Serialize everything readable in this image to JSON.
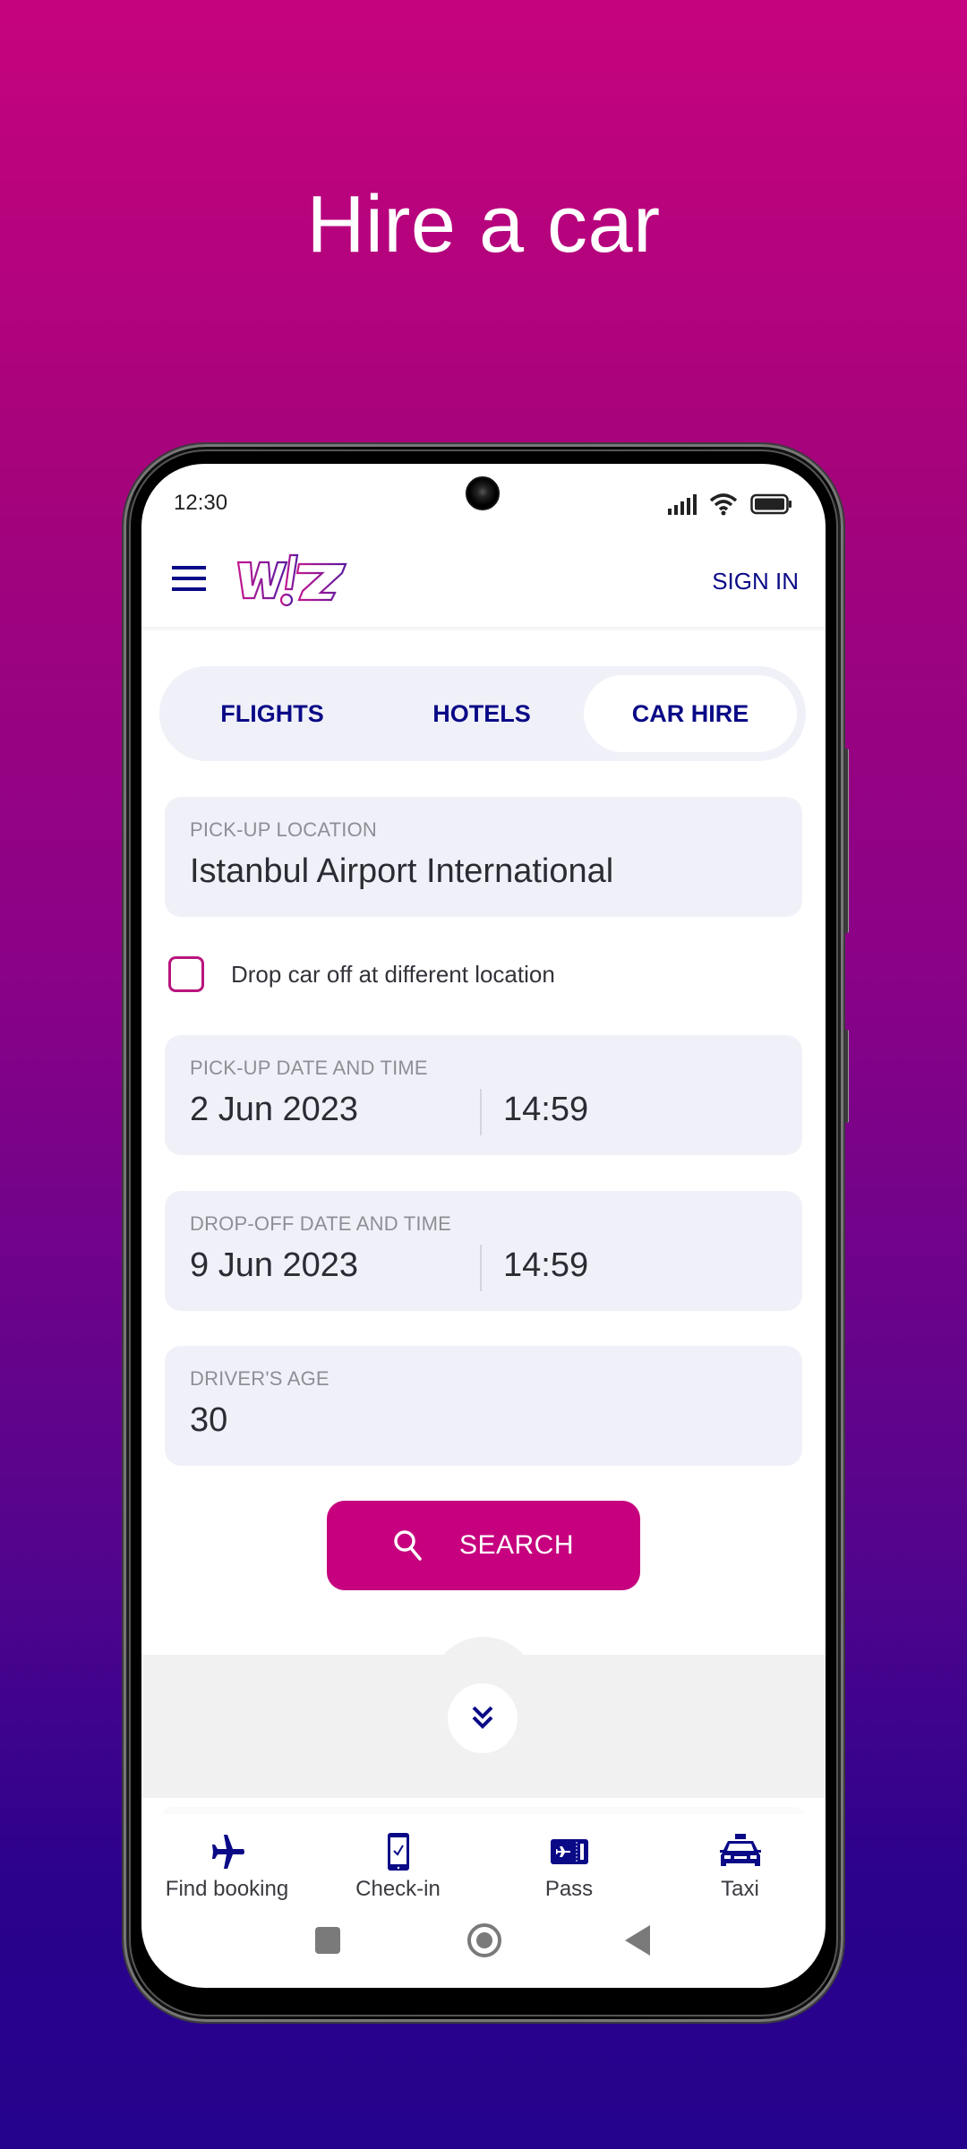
{
  "promo": {
    "headline": "Hire a car"
  },
  "status_bar": {
    "time": "12:30",
    "icons": [
      "signal-icon",
      "wifi-icon",
      "battery-icon"
    ]
  },
  "app_bar": {
    "logo_text": "W!zz",
    "sign_in_label": "SIGN IN"
  },
  "tabs": [
    {
      "label": "FLIGHTS",
      "active": false
    },
    {
      "label": "HOTELS",
      "active": false
    },
    {
      "label": "CAR HIRE",
      "active": true
    }
  ],
  "form": {
    "pickup_location": {
      "label": "PICK-UP LOCATION",
      "value": "Istanbul Airport International"
    },
    "different_dropoff": {
      "label": "Drop car off at different location",
      "checked": false
    },
    "pickup_datetime": {
      "label": "PICK-UP DATE AND TIME",
      "date": "2 Jun 2023",
      "time": "14:59"
    },
    "dropoff_datetime": {
      "label": "DROP-OFF DATE AND TIME",
      "date": "9 Jun 2023",
      "time": "14:59"
    },
    "drivers_age": {
      "label": "DRIVER'S AGE",
      "value": "30"
    },
    "search_label": "SEARCH"
  },
  "bottom_nav": [
    {
      "label": "Find booking",
      "icon": "airplane-icon"
    },
    {
      "label": "Check-in",
      "icon": "mobile-check-icon"
    },
    {
      "label": "Pass",
      "icon": "boarding-pass-icon"
    },
    {
      "label": "Taxi",
      "icon": "taxi-icon"
    }
  ],
  "colors": {
    "brand_magenta": "#c6007e",
    "brand_navy": "#0a0a87",
    "field_bg": "#f0f1f8",
    "bg_top": "#c6037e",
    "bg_bottom": "#26038c"
  }
}
